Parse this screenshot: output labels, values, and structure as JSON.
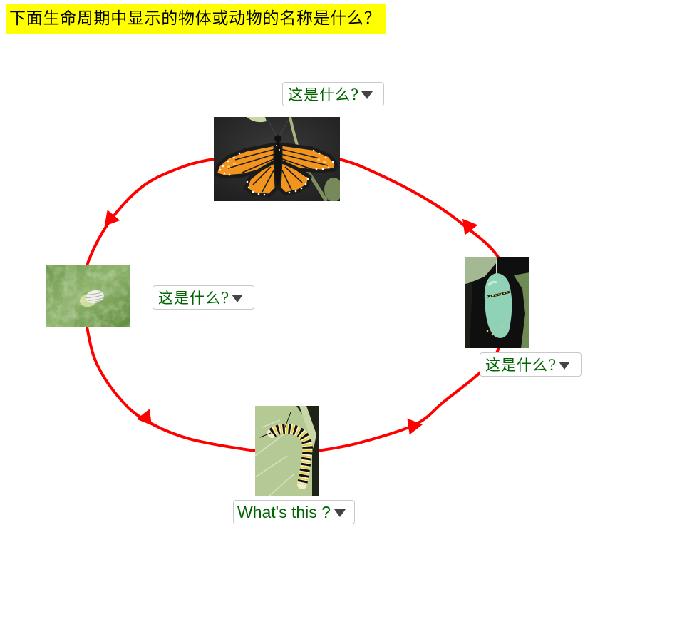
{
  "page": {
    "title": "下面生命周期中显示的物体或动物的名称是什么？"
  },
  "colors": {
    "title_background": "#ffff00",
    "cycle_line": "#ff0000",
    "dropdown_text": "#006400",
    "dropdown_caret": "#444444"
  },
  "life_cycle": {
    "stages": [
      {
        "image": "monarch-butterfly-photo",
        "dropdown": {
          "selected": "这是什么?",
          "icon": "caret-down-icon"
        }
      },
      {
        "image": "chrysalis-photo",
        "dropdown": {
          "selected": "这是什么?",
          "icon": "caret-down-icon"
        }
      },
      {
        "image": "caterpillar-photo",
        "dropdown": {
          "selected": "What's this ?",
          "icon": "caret-down-icon"
        }
      },
      {
        "image": "egg-on-leaf-photo",
        "dropdown": {
          "selected": "这是什么?",
          "icon": "caret-down-icon"
        }
      }
    ],
    "arrows": [
      "butterfly → egg",
      "egg → caterpillar",
      "caterpillar → chrysalis",
      "chrysalis → butterfly"
    ]
  }
}
